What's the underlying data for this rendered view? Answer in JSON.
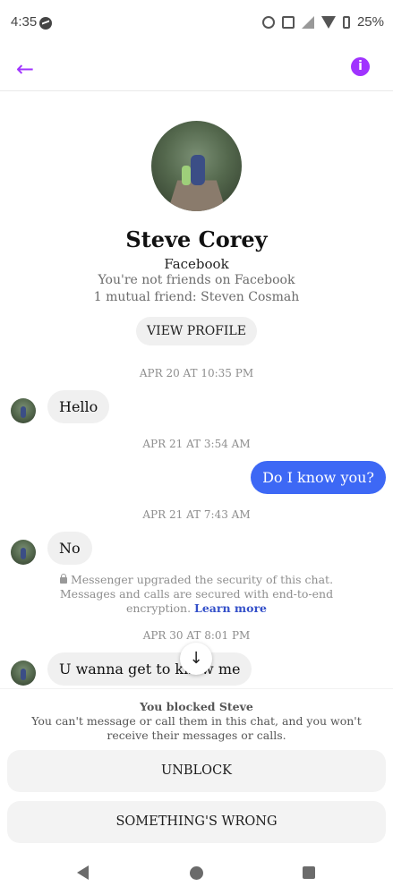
{
  "status_bar": {
    "time": "4:35",
    "battery": "25%",
    "icons": [
      "messenger-icon",
      "alarm-icon",
      "nfc-icon",
      "signal-icon",
      "wifi-icon",
      "battery-icon"
    ]
  },
  "header": {
    "back_icon": "arrow-left-icon",
    "back_glyph": "←",
    "info_icon": "info-icon",
    "info_glyph": "i",
    "accent_color": "#a033ff"
  },
  "profile": {
    "name": "Steve Corey",
    "source": "Facebook",
    "friend_status": "You're not friends on Facebook",
    "mutual": "1 mutual friend: Steven Cosmah",
    "view_profile_label": "VIEW PROFILE"
  },
  "conversation": {
    "timestamps": [
      "APR 20 AT 10:35 PM",
      "APR 21 AT 3:54 AM",
      "APR 21 AT 7:43 AM",
      "APR 30 AT 8:01 PM"
    ],
    "messages": [
      {
        "sender": "them",
        "text": "Hello"
      },
      {
        "sender": "me",
        "text": "Do I know you?"
      },
      {
        "sender": "them",
        "text": "No"
      },
      {
        "sender": "them",
        "text": "U wanna get to know me"
      }
    ],
    "outgoing_color": "#3d68f5",
    "security_note": "Messenger upgraded the security of this chat. Messages and calls are secured with end-to-end encryption.",
    "learn_more": "Learn more",
    "scroll_down_glyph": "↓"
  },
  "blocked": {
    "title": "You blocked Steve",
    "description": "You can't message or call them in this chat, and you won't receive their messages or calls.",
    "unblock_label": "UNBLOCK",
    "wrong_label": "SOMETHING'S WRONG"
  }
}
